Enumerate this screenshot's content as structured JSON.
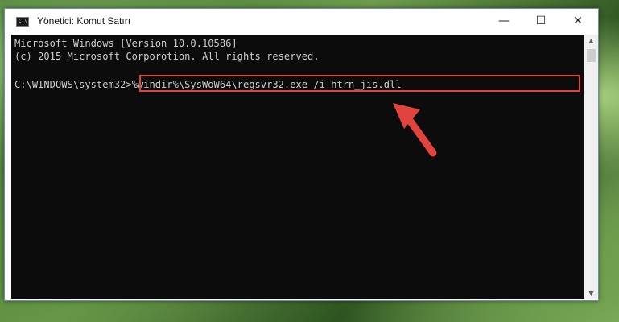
{
  "window": {
    "title": "Yönetici: Komut Satırı",
    "icon": "cmd-icon",
    "icon_glyph": "C:\\",
    "minimize_glyph": "—",
    "maximize_glyph": "☐",
    "close_glyph": "✕"
  },
  "console": {
    "line1": "Microsoft Windows [Version 10.0.10586]",
    "line2": "(c) 2015 Microsoft Corporotion. All rights reserved.",
    "prompt": "C:\\WINDOWS\\system32>",
    "command": "%windir%\\SysWoW64\\regsvr32.exe /i htrn_jis.dll"
  },
  "scrollbar": {
    "up_glyph": "▲",
    "down_glyph": "▼"
  },
  "annotation": {
    "highlight_color": "#e0443c",
    "arrow_color": "#e0443c"
  }
}
